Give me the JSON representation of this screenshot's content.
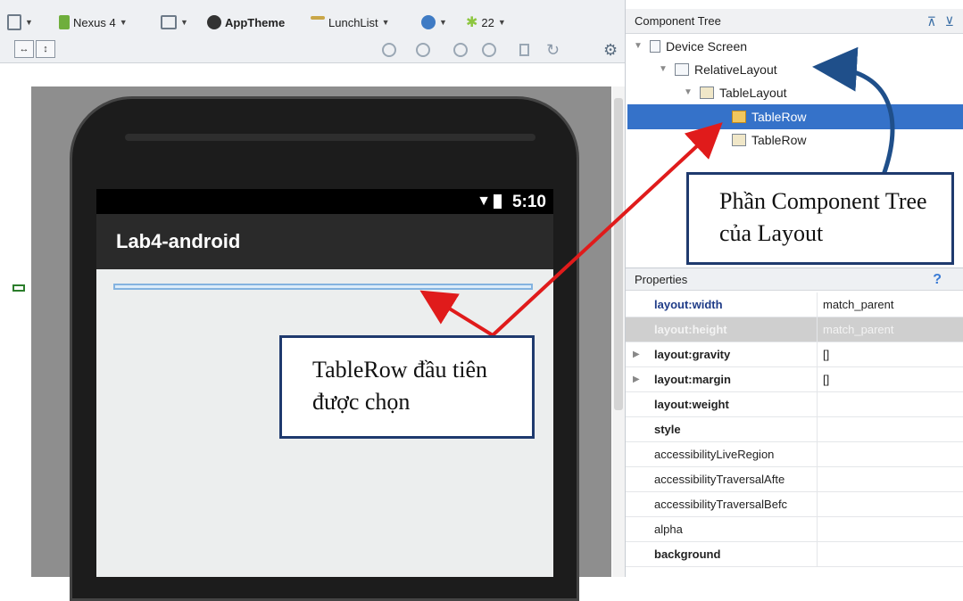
{
  "toolbar": {
    "device": "Nexus 4",
    "theme": "AppTheme",
    "activity": "LunchList",
    "api": "22"
  },
  "device_preview": {
    "status_time": "5:10",
    "app_title": "Lab4-android"
  },
  "component_tree": {
    "header": "Component Tree",
    "nodes": [
      {
        "label": "Device Screen"
      },
      {
        "label": "RelativeLayout"
      },
      {
        "label": "TableLayout"
      },
      {
        "label": "TableRow",
        "selected": true
      },
      {
        "label": "TableRow"
      }
    ]
  },
  "properties": {
    "header": "Properties",
    "help": "?",
    "rows": [
      {
        "name": "layout:width",
        "value": "match_parent"
      },
      {
        "name": "layout:height",
        "value": "match_parent"
      },
      {
        "name": "layout:gravity",
        "value": "[]"
      },
      {
        "name": "layout:margin",
        "value": "[]"
      },
      {
        "name": "layout:weight",
        "value": ""
      },
      {
        "name": "style",
        "value": ""
      },
      {
        "name": "accessibilityLiveRegion",
        "value": ""
      },
      {
        "name": "accessibilityTraversalAfte",
        "value": ""
      },
      {
        "name": "accessibilityTraversalBefc",
        "value": ""
      },
      {
        "name": "alpha",
        "value": ""
      },
      {
        "name": "background",
        "value": ""
      }
    ]
  },
  "callouts": {
    "component_tree": "Phần Component Tree của Layout",
    "first_row": "TableRow đầu tiên được chọn"
  },
  "colors": {
    "selection": "#3572c9",
    "callout_border": "#1f3a6e",
    "arrow_red": "#e01b1b",
    "arrow_blue": "#1f4f8a"
  }
}
